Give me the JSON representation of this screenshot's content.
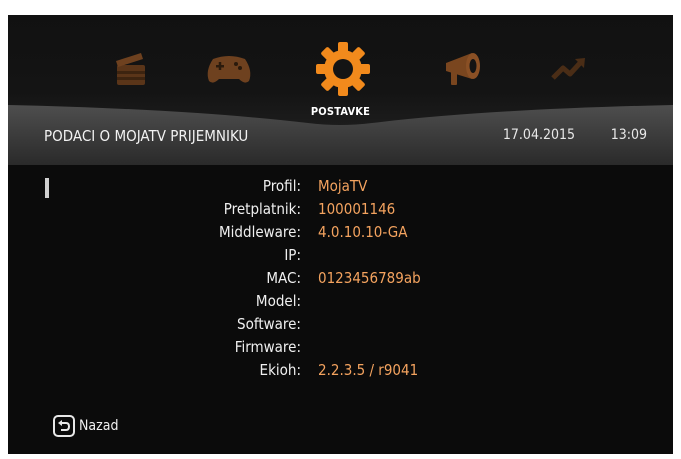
{
  "menu": {
    "items": [
      {
        "icon": "clapperboard-icon",
        "label": ""
      },
      {
        "icon": "gamepad-icon",
        "label": ""
      },
      {
        "icon": "gear-icon",
        "label": "POSTAVKE",
        "active": true
      },
      {
        "icon": "megaphone-icon",
        "label": ""
      },
      {
        "icon": "trend-arrow-icon",
        "label": ""
      }
    ],
    "active_label": "POSTAVKE"
  },
  "header": {
    "title": "PODACI O MOJATV PRIJEMNIKU",
    "date": "17.04.2015",
    "time": "13:09"
  },
  "info": {
    "rows": [
      {
        "label": "Profil:",
        "value": "MojaTV"
      },
      {
        "label": "Pretplatnik:",
        "value": "100001146"
      },
      {
        "label": "Middleware:",
        "value": "4.0.10.10-GA"
      },
      {
        "label": "IP:",
        "value": ""
      },
      {
        "label": "MAC:",
        "value": "0123456789ab"
      },
      {
        "label": "Model:",
        "value": ""
      },
      {
        "label": "Software:",
        "value": ""
      },
      {
        "label": "Firmware:",
        "value": ""
      },
      {
        "label": "Ekioh:",
        "value": "2.2.3.5 / r9041"
      }
    ]
  },
  "footer": {
    "back_label": "Nazad"
  },
  "colors": {
    "accent": "#f4a35f",
    "active_icon": "#f28a1c",
    "inactive_icon": "#6b3f1e"
  }
}
